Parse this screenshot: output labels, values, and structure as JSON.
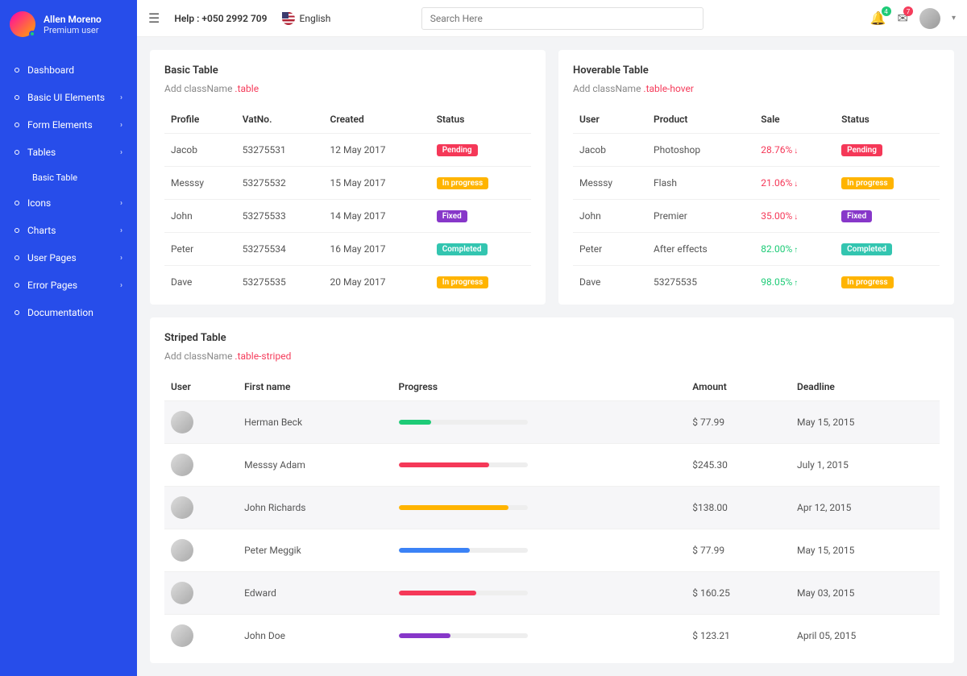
{
  "user": {
    "name": "Allen Moreno",
    "role": "Premium user"
  },
  "nav": {
    "items": [
      {
        "label": "Dashboard",
        "arrow": false
      },
      {
        "label": "Basic UI Elements",
        "arrow": true
      },
      {
        "label": "Form Elements",
        "arrow": true
      },
      {
        "label": "Tables",
        "arrow": true
      },
      {
        "label": "Icons",
        "arrow": true
      },
      {
        "label": "Charts",
        "arrow": true
      },
      {
        "label": "User Pages",
        "arrow": true
      },
      {
        "label": "Error Pages",
        "arrow": true
      },
      {
        "label": "Documentation",
        "arrow": false
      }
    ],
    "sub": "Basic Table"
  },
  "topbar": {
    "help": "Help : +050 2992 709",
    "lang": "English",
    "search_placeholder": "Search Here",
    "bell_badge": "4",
    "mail_badge": "7"
  },
  "basic": {
    "title": "Basic Table",
    "sub": "Add className",
    "code": ".table",
    "headers": [
      "Profile",
      "VatNo.",
      "Created",
      "Status"
    ],
    "rows": [
      {
        "c0": "Jacob",
        "c1": "53275531",
        "c2": "12 May 2017",
        "status": "Pending",
        "cls": "b-red"
      },
      {
        "c0": "Messsy",
        "c1": "53275532",
        "c2": "15 May 2017",
        "status": "In progress",
        "cls": "b-yellow"
      },
      {
        "c0": "John",
        "c1": "53275533",
        "c2": "14 May 2017",
        "status": "Fixed",
        "cls": "b-purple"
      },
      {
        "c0": "Peter",
        "c1": "53275534",
        "c2": "16 May 2017",
        "status": "Completed",
        "cls": "b-teal"
      },
      {
        "c0": "Dave",
        "c1": "53275535",
        "c2": "20 May 2017",
        "status": "In progress",
        "cls": "b-yellow"
      }
    ]
  },
  "hover": {
    "title": "Hoverable Table",
    "sub": "Add className",
    "code": ".table-hover",
    "headers": [
      "User",
      "Product",
      "Sale",
      "Status"
    ],
    "rows": [
      {
        "c0": "Jacob",
        "c1": "Photoshop",
        "sale": "28.76%",
        "dir": "down",
        "status": "Pending",
        "cls": "b-red"
      },
      {
        "c0": "Messsy",
        "c1": "Flash",
        "sale": "21.06%",
        "dir": "down",
        "status": "In progress",
        "cls": "b-yellow"
      },
      {
        "c0": "John",
        "c1": "Premier",
        "sale": "35.00%",
        "dir": "down",
        "status": "Fixed",
        "cls": "b-purple"
      },
      {
        "c0": "Peter",
        "c1": "After effects",
        "sale": "82.00%",
        "dir": "up",
        "status": "Completed",
        "cls": "b-teal"
      },
      {
        "c0": "Dave",
        "c1": "53275535",
        "sale": "98.05%",
        "dir": "up",
        "status": "In progress",
        "cls": "b-yellow"
      }
    ]
  },
  "striped": {
    "title": "Striped Table",
    "sub": "Add className",
    "code": ".table-striped",
    "headers": [
      "User",
      "First name",
      "Progress",
      "Amount",
      "Deadline"
    ],
    "rows": [
      {
        "name": "Herman Beck",
        "prog": 25,
        "pcls": "pc-teal",
        "amt": "$ 77.99",
        "dl": "May 15, 2015"
      },
      {
        "name": "Messsy Adam",
        "prog": 70,
        "pcls": "pc-red",
        "amt": "$245.30",
        "dl": "July 1, 2015"
      },
      {
        "name": "John Richards",
        "prog": 85,
        "pcls": "pc-yellow",
        "amt": "$138.00",
        "dl": "Apr 12, 2015"
      },
      {
        "name": "Peter Meggik",
        "prog": 55,
        "pcls": "pc-blue",
        "amt": "$ 77.99",
        "dl": "May 15, 2015"
      },
      {
        "name": "Edward",
        "prog": 60,
        "pcls": "pc-red",
        "amt": "$ 160.25",
        "dl": "May 03, 2015"
      },
      {
        "name": "John Doe",
        "prog": 40,
        "pcls": "pc-purple",
        "amt": "$ 123.21",
        "dl": "April 05, 2015"
      }
    ]
  }
}
